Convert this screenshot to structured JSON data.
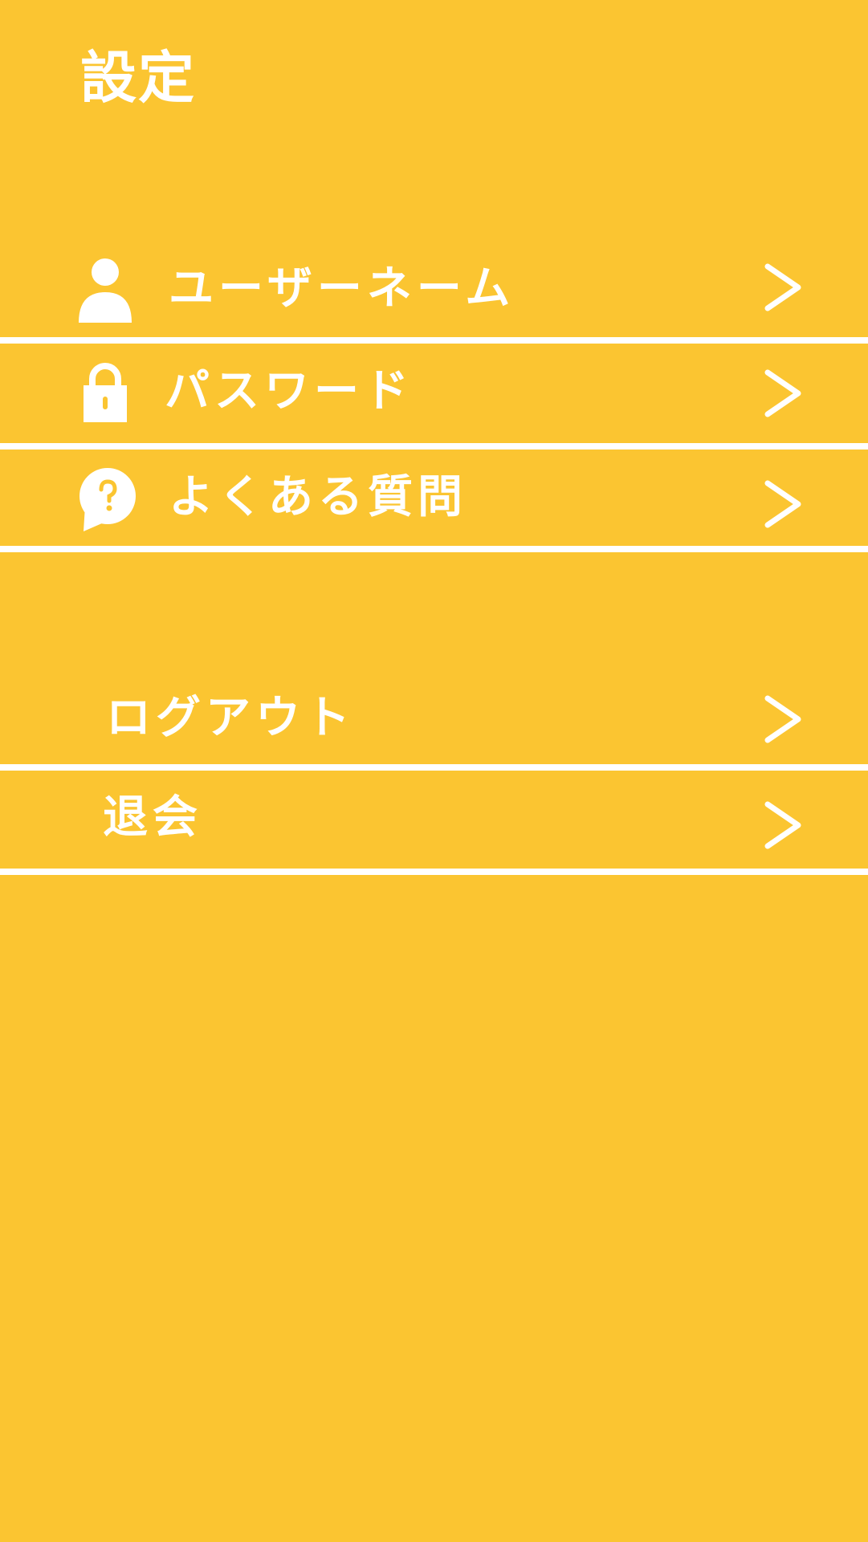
{
  "header": {
    "title": "設定"
  },
  "colors": {
    "background": "#FBC531",
    "foreground": "#FFFFFF"
  },
  "menu": {
    "items": [
      {
        "label": "ユーザーネーム",
        "icon": "user-icon"
      },
      {
        "label": "パスワード",
        "icon": "lock-icon"
      },
      {
        "label": "よくある質問",
        "icon": "faq-icon"
      },
      {
        "label": "ログアウト",
        "icon": ""
      },
      {
        "label": "退会",
        "icon": ""
      }
    ]
  }
}
